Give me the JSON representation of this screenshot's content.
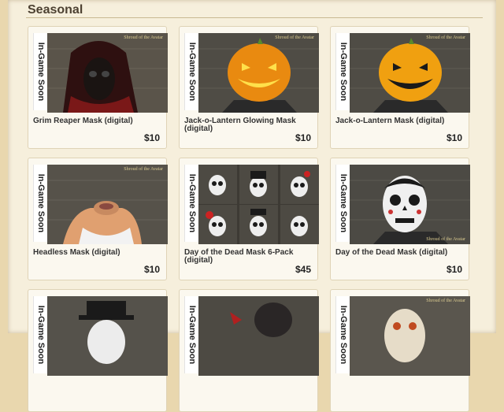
{
  "section": {
    "title": "Seasonal"
  },
  "badge_label": "In-Game Soon",
  "thumb_logo": "Shroud of the Avatar",
  "products": [
    {
      "name": "Grim Reaper Mask (digital)",
      "price": "$10"
    },
    {
      "name": "Jack-o-Lantern Glowing Mask (digital)",
      "price": "$10"
    },
    {
      "name": "Jack-o-Lantern Mask (digital)",
      "price": "$10"
    },
    {
      "name": "Headless Mask (digital)",
      "price": "$10"
    },
    {
      "name": "Day of the Dead Mask 6-Pack (digital)",
      "price": "$45"
    },
    {
      "name": "Day of the Dead Mask (digital)",
      "price": "$10"
    },
    {
      "name": "",
      "price": ""
    },
    {
      "name": "",
      "price": ""
    },
    {
      "name": "",
      "price": ""
    }
  ],
  "colors": {
    "background": "#e9d7ae",
    "panel": "#f6efdc",
    "card": "#fbf8ef",
    "text": "#333333"
  }
}
